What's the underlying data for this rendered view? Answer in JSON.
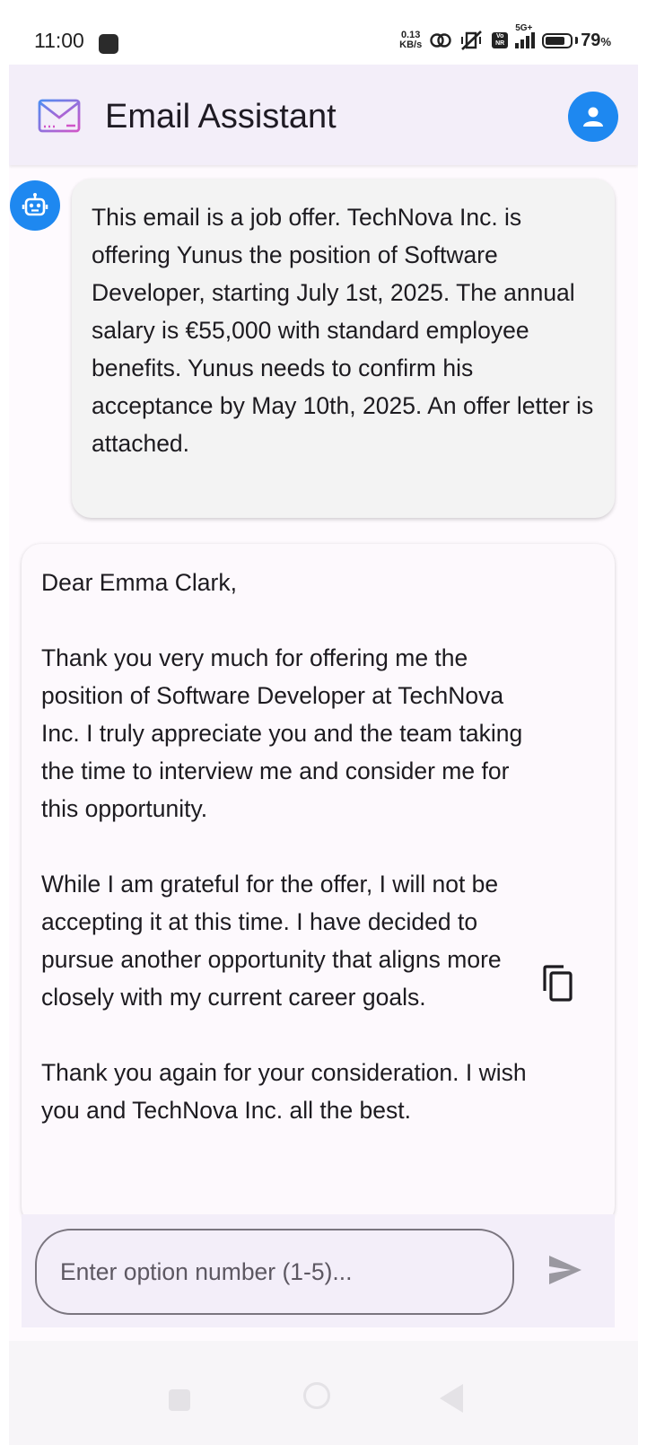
{
  "status_bar": {
    "time": "11:00",
    "net_speed_value": "0.13",
    "net_speed_unit": "KB/s",
    "volte_label": "Vo NR",
    "network_label": "5G+",
    "battery_percent": "79",
    "battery_percent_sign": "%",
    "battery_level": 0.79
  },
  "app_bar": {
    "title": "Email Assistant",
    "logo_icon": "mail-icon",
    "profile_icon": "person-icon"
  },
  "chat": {
    "bot_icon": "robot-icon",
    "summary_message": "This email is a job offer. TechNova Inc. is offering Yunus the position of Software Developer, starting July 1st, 2025. The annual salary is €55,000 with standard employee benefits. Yunus needs to confirm his acceptance by May 10th, 2025. An offer letter is attached.",
    "reply": {
      "greeting": "Dear Emma Clark,",
      "paragraph_1": "Thank you very much for offering me the position of Software Developer at TechNova Inc. I truly appreciate you and the team taking the time to interview me and consider me for this opportunity.",
      "paragraph_2": "While I am grateful for the offer, I will not be accepting it at this time. I have decided to pursue another opportunity that aligns more closely with my current career goals.",
      "paragraph_3": "Thank you again for your consideration. I wish you and TechNova Inc. all the best.",
      "copy_icon": "copy-icon"
    }
  },
  "input": {
    "placeholder": "Enter option number (1-5)...",
    "send_icon": "send-icon"
  },
  "colors": {
    "accent": "#1e88f0",
    "app_bar_bg": "#f3eef9",
    "bubble_bg": "#f3f3f3",
    "text": "#1d1b20"
  }
}
